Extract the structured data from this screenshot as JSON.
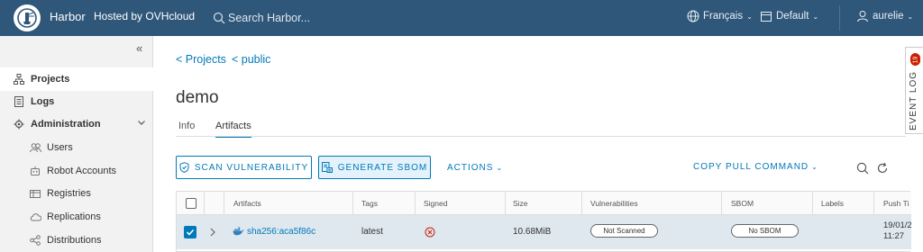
{
  "header": {
    "brand": "Harbor",
    "hosted": "Hosted by OVHcloud",
    "search_placeholder": "Search Harbor...",
    "language": "Français",
    "theme": "Default",
    "user": "aurelie"
  },
  "sidebar": {
    "items": [
      {
        "label": "Projects"
      },
      {
        "label": "Logs"
      },
      {
        "label": "Administration"
      },
      {
        "label": "Users"
      },
      {
        "label": "Robot Accounts"
      },
      {
        "label": "Registries"
      },
      {
        "label": "Replications"
      },
      {
        "label": "Distributions"
      }
    ]
  },
  "breadcrumb": {
    "projects": "< Projects",
    "public": "< public"
  },
  "page": {
    "title": "demo"
  },
  "tabs": [
    {
      "label": "Info"
    },
    {
      "label": "Artifacts"
    }
  ],
  "toolbar": {
    "scan": "SCAN VULNERABILITY",
    "sbom": "GENERATE SBOM",
    "actions": "ACTIONS",
    "pull": "COPY PULL COMMAND"
  },
  "table": {
    "columns": [
      "Artifacts",
      "Tags",
      "Signed",
      "Size",
      "Vulnerabilities",
      "SBOM",
      "Labels",
      "Push Ti"
    ],
    "rows": [
      {
        "artifact": "sha256:aca5f86c",
        "tag": "latest",
        "size": "10.68MiB",
        "vulnerabilities": "Not Scanned",
        "sbom": "No SBOM",
        "push_date": "19/01/2",
        "push_time": "11:27"
      }
    ]
  },
  "event_log": {
    "label": "EVENT LOG",
    "count": "19"
  },
  "colors": {
    "header": "#2f5779",
    "accent": "#0079b8",
    "badge": "#c92100"
  }
}
